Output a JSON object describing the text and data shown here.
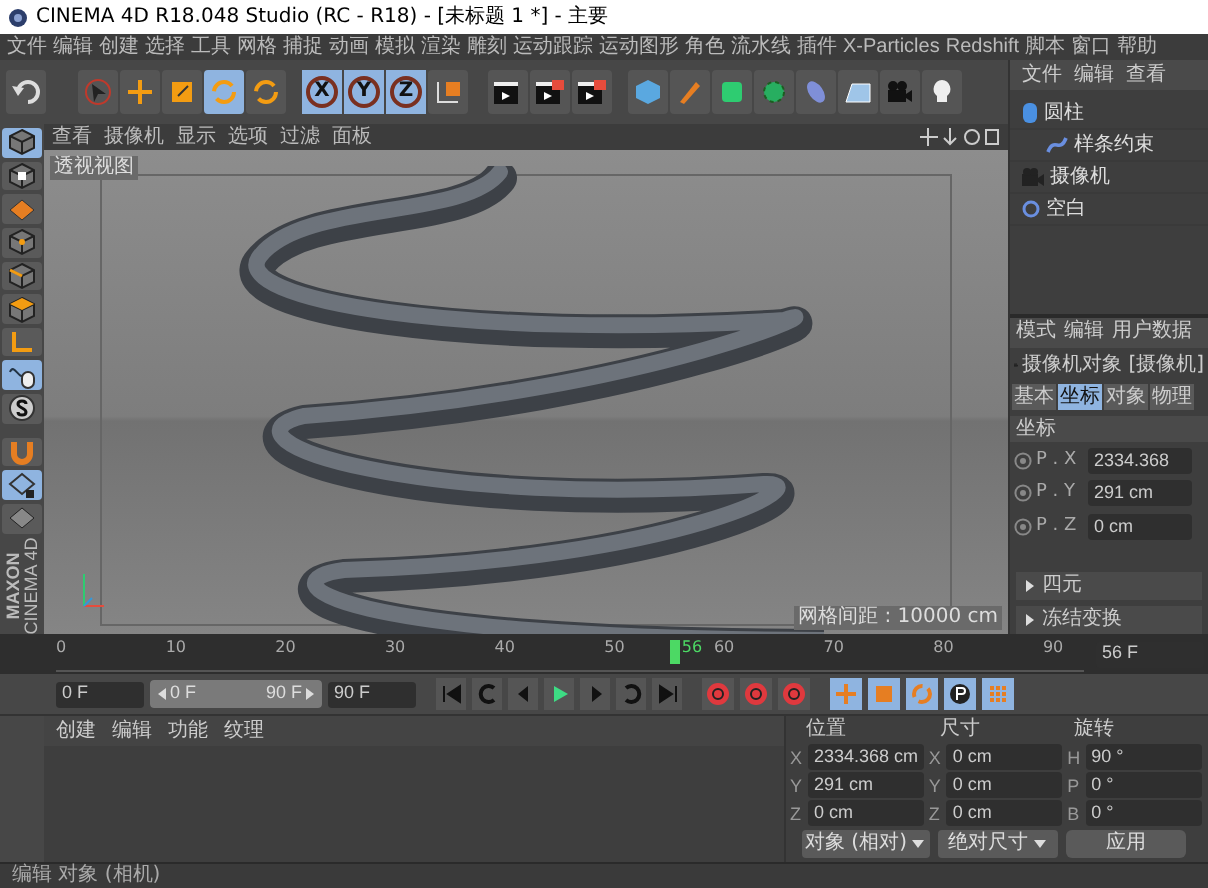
{
  "window": {
    "title": "CINEMA 4D R18.048 Studio (RC - R18) - [未标题 1 *] - 主要"
  },
  "menu_bar": [
    "文件",
    "编辑",
    "创建",
    "选择",
    "工具",
    "网格",
    "捕捉",
    "动画",
    "模拟",
    "渲染",
    "雕刻",
    "运动跟踪",
    "运动图形",
    "角色",
    "流水线",
    "插件",
    "X-Particles",
    "Redshift",
    "脚本",
    "窗口",
    "帮助"
  ],
  "mode_tools": [
    {
      "selected": false
    },
    {
      "selected": false
    },
    {
      "selected": false
    },
    {
      "selected": true
    },
    {
      "selected": false
    }
  ],
  "axis_locks": [
    {
      "label": "X",
      "locked": true
    },
    {
      "label": "Y",
      "locked": true
    },
    {
      "label": "Z",
      "locked": true
    }
  ],
  "viewport": {
    "menu": [
      "查看",
      "摄像机",
      "显示",
      "选项",
      "过滤",
      "面板"
    ],
    "view_label": "透视视图",
    "grid_spacing": "网格间距 : 10000 cm"
  },
  "object_manager": {
    "menu": [
      "文件",
      "编辑",
      "查看"
    ],
    "objects": [
      {
        "name": "圆柱",
        "kind": "cylinder",
        "children": [
          {
            "name": "样条约束",
            "kind": "spline"
          }
        ]
      },
      {
        "name": "摄像机",
        "kind": "camera"
      },
      {
        "name": "空白",
        "kind": "null"
      }
    ]
  },
  "attributes": {
    "menu": [
      "模式",
      "编辑",
      "用户数据"
    ],
    "object_title": "摄像机对象 [摄像机]",
    "tabs": [
      {
        "label": "基本",
        "selected": false
      },
      {
        "label": "坐标",
        "selected": true
      },
      {
        "label": "对象",
        "selected": false
      },
      {
        "label": "物理",
        "selected": false
      }
    ],
    "section": "坐标",
    "fields": [
      {
        "label": "P . X",
        "value": "2334.368"
      },
      {
        "label": "P . Y",
        "value": "291 cm"
      },
      {
        "label": "P . Z",
        "value": "0 cm"
      }
    ],
    "groups": [
      "四元",
      "冻结变换"
    ]
  },
  "timeline": {
    "ticks": [
      "0",
      "10",
      "20",
      "30",
      "40",
      "50",
      "60",
      "70",
      "80",
      "90"
    ],
    "current_frame": "56",
    "playhead": {
      "level": 0.622
    },
    "frame_field": "56 F"
  },
  "playback": {
    "start": "0 F",
    "range_start": "0 F",
    "range_end": "90 F",
    "end": "90 F",
    "range": {
      "level": 1
    }
  },
  "material_manager": {
    "menu": [
      "创建",
      "编辑",
      "功能",
      "纹理"
    ]
  },
  "coordinates": {
    "headers": [
      "位置",
      "尺寸",
      "旋转"
    ],
    "rows": [
      {
        "position_axis": "X",
        "position": "2334.368 cm",
        "size_axis": "X",
        "size": "0 cm",
        "rotation_axis": "H",
        "rotation": "90 °"
      },
      {
        "position_axis": "Y",
        "position": "291 cm",
        "size_axis": "Y",
        "size": "0 cm",
        "rotation_axis": "P",
        "rotation": "0 °"
      },
      {
        "position_axis": "Z",
        "position": "0 cm",
        "size_axis": "Z",
        "size": "0 cm",
        "rotation_axis": "B",
        "rotation": "0 °"
      }
    ],
    "position_mode": "对象 (相对)",
    "size_mode": "绝对尺寸",
    "apply": "应用"
  },
  "logo": {
    "line_1": "MAXON",
    "line_2": "CINEMA 4D"
  },
  "status_bar": "编辑 对象 (相机)"
}
